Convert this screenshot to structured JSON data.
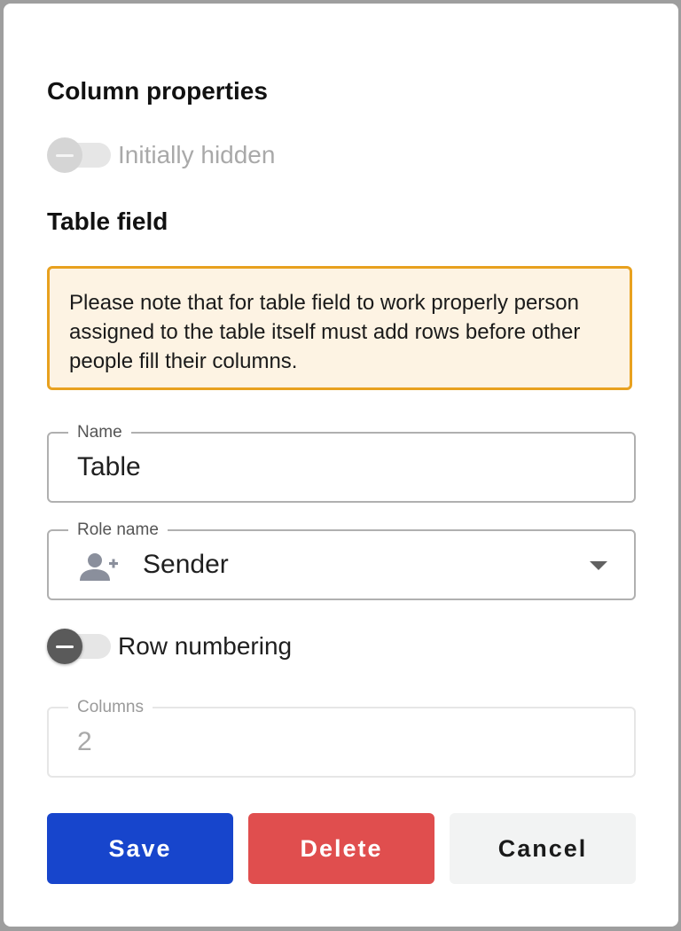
{
  "column_properties": {
    "title": "Column properties",
    "initially_hidden_label": "Initially hidden",
    "initially_hidden_state": "off"
  },
  "table_field": {
    "title": "Table field",
    "note": "Please note that for table field to work properly person assigned to the table itself must add rows before other people fill their columns.",
    "name": {
      "label": "Name",
      "value": "Table"
    },
    "role": {
      "label": "Role name",
      "value": "Sender",
      "icon": "person-add-icon"
    },
    "row_numbering": {
      "label": "Row numbering",
      "state": "off"
    },
    "columns": {
      "label": "Columns",
      "value": "2"
    }
  },
  "actions": {
    "save_label": "Save",
    "delete_label": "Delete",
    "cancel_label": "Cancel"
  },
  "colors": {
    "save": "#1745cc",
    "delete": "#e04e4e",
    "cancel": "#f2f3f3",
    "note_border": "#e8a11f",
    "note_background": "#fdf3e3"
  }
}
